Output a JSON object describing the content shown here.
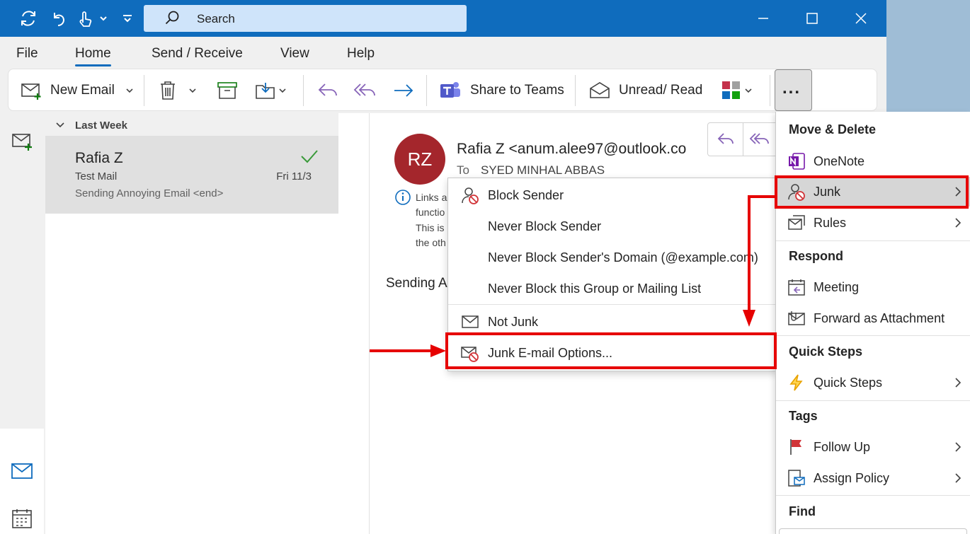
{
  "titlebar": {
    "search_placeholder": "Search"
  },
  "menu_tabs": [
    "File",
    "Home",
    "Send / Receive",
    "View",
    "Help"
  ],
  "ribbon": {
    "new_email": "New Email",
    "share_to_teams": "Share to Teams",
    "unread_read": "Unread/ Read",
    "more": "..."
  },
  "message_list": {
    "group_label": "Last Week",
    "items": [
      {
        "sender": "Rafia Z",
        "subject": "Test Mail",
        "date": "Fri 11/3",
        "preview": "Sending Annoying Email <end>"
      }
    ]
  },
  "reading_pane": {
    "avatar_initials": "RZ",
    "from": "Rafia Z <anum.alee97@outlook.co",
    "to_label": "To",
    "to_value": "SYED MINHAL ABBAS",
    "info_lines": [
      "Links a",
      "functio",
      "This is",
      "the oth"
    ],
    "body_start": "Sending A"
  },
  "junk_submenu": {
    "items": [
      {
        "label": "Block Sender",
        "icon": "block-sender-icon"
      },
      {
        "label": "Never Block Sender",
        "icon": ""
      },
      {
        "label": "Never Block Sender's Domain (@example.com)",
        "icon": ""
      },
      {
        "label": "Never Block this Group or Mailing List",
        "icon": ""
      },
      {
        "label": "Not Junk",
        "icon": "envelope-icon"
      },
      {
        "label": "Junk E-mail Options...",
        "icon": "junk-options-icon"
      }
    ]
  },
  "right_menu": {
    "sections": {
      "move_delete": "Move & Delete",
      "respond": "Respond",
      "quick_steps": "Quick Steps",
      "tags": "Tags",
      "find": "Find"
    },
    "items": {
      "onenote": "OneNote",
      "junk": "Junk",
      "rules": "Rules",
      "meeting": "Meeting",
      "forward_attachment": "Forward as Attachment",
      "quick_steps": "Quick Steps",
      "follow_up": "Follow Up",
      "assign_policy": "Assign Policy"
    }
  },
  "colors": {
    "brand_blue": "#0f6cbd",
    "avatar_red": "#a4262c",
    "highlight_red": "#e60000"
  }
}
